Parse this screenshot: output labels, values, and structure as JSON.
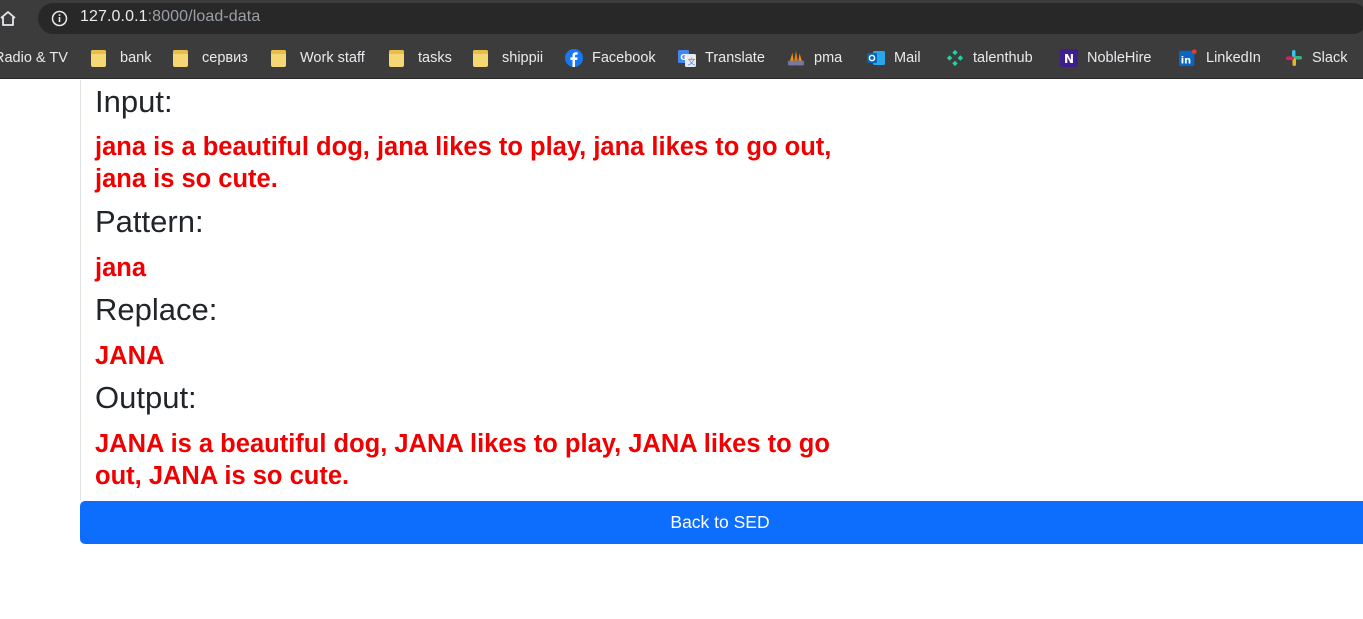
{
  "browser": {
    "url_host": "127.0.0.1",
    "url_path": ":8000/load-data",
    "bookmarks": [
      {
        "label": "Radio & TV",
        "icon": "folder-icon"
      },
      {
        "label": "bank",
        "icon": "folder-icon"
      },
      {
        "label": "сервиз",
        "icon": "folder-icon"
      },
      {
        "label": "Work staff",
        "icon": "folder-icon"
      },
      {
        "label": "tasks",
        "icon": "folder-icon"
      },
      {
        "label": "shippii",
        "icon": "folder-icon"
      },
      {
        "label": "Facebook",
        "icon": "facebook-icon"
      },
      {
        "label": "Translate",
        "icon": "google-translate-icon"
      },
      {
        "label": "pma",
        "icon": "phpmyadmin-icon"
      },
      {
        "label": "Mail",
        "icon": "outlook-mail-icon"
      },
      {
        "label": "talenthub",
        "icon": "talenthub-icon"
      },
      {
        "label": "NobleHire",
        "icon": "noblehire-icon"
      },
      {
        "label": "LinkedIn",
        "icon": "linkedin-icon"
      },
      {
        "label": "Slack",
        "icon": "slack-icon"
      }
    ]
  },
  "result": {
    "input_label": "Input:",
    "input_value": "jana is a beautiful dog, jana likes to play, jana likes to go out, jana is so cute.",
    "pattern_label": "Pattern:",
    "pattern_value": "jana",
    "replace_label": "Replace:",
    "replace_value": "JANA",
    "output_label": "Output:",
    "output_value": "JANA is a beautiful dog, JANA likes to play, JANA likes to go out, JANA is so cute."
  },
  "actions": {
    "back_label": "Back to SED"
  },
  "colors": {
    "value_text": "#f00000",
    "button": "#0d6efd",
    "chrome_bg": "#3c3c3c"
  }
}
